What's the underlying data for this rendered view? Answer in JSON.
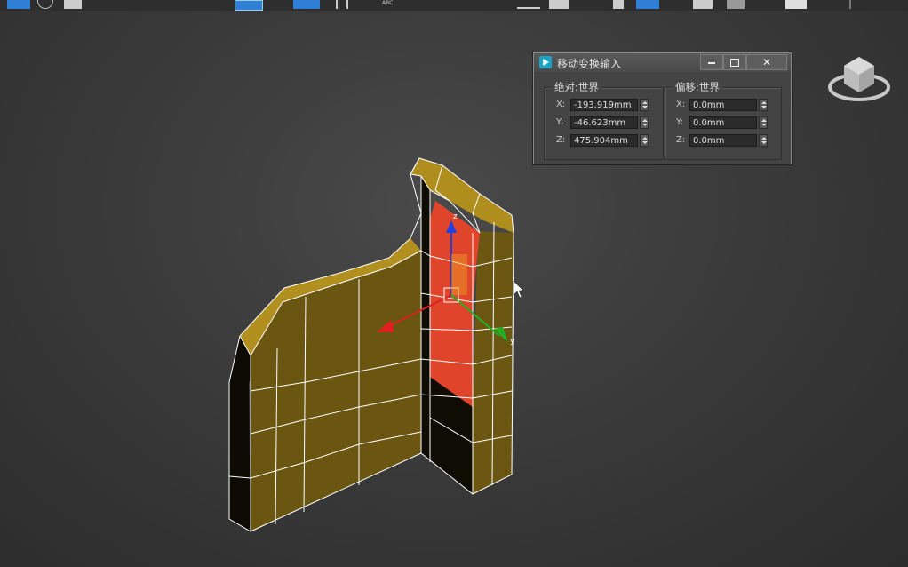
{
  "dialog": {
    "title": "移动变换输入",
    "minimize_icon": "minimize-icon",
    "restore_icon": "restore-icon",
    "close_icon": "close-icon",
    "absolute_group": {
      "title": "绝对:世界",
      "x_label": "X:",
      "x_value": "-193.919mm",
      "y_label": "Y:",
      "y_value": "-46.623mm",
      "z_label": "Z:",
      "z_value": "475.904mm"
    },
    "offset_group": {
      "title": "偏移:世界",
      "x_label": "X:",
      "x_value": "0.0mm",
      "y_label": "Y:",
      "y_value": "0.0mm",
      "z_label": "Z:",
      "z_value": "0.0mm"
    }
  },
  "gizmo": {
    "z_label": "z",
    "y_label": "y"
  },
  "toolbar": {
    "text_tool_label": "ABC"
  },
  "colors": {
    "viewport_bg": "#3a3a3a",
    "mesh_face": "#6e5a10",
    "mesh_top": "#b08e1e",
    "selected_face": "#e0452c",
    "wire": "#ffffff",
    "axis_x": "#e02020",
    "axis_y": "#20b020",
    "axis_z": "#2040e0"
  }
}
